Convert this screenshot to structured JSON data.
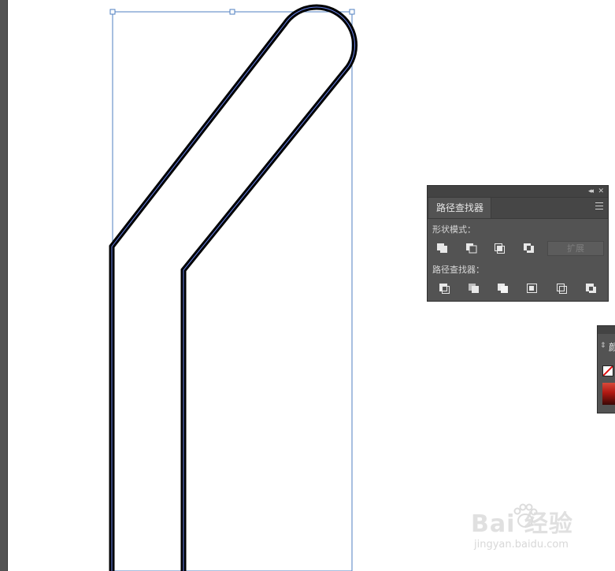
{
  "pathfinder": {
    "tab_title": "路径查找器",
    "shape_modes_label": "形状模式：",
    "pathfinders_label": "路径查找器：",
    "expand_label": "扩展",
    "shape_mode_icons": [
      "unite-icon",
      "minus-front-icon",
      "intersect-icon",
      "exclude-icon"
    ],
    "pathfinder_icons": [
      "divide-icon",
      "trim-icon",
      "merge-icon",
      "crop-icon",
      "outline-icon",
      "minus-back-icon"
    ]
  },
  "color_panel": {
    "tab_fragment": "颜"
  },
  "watermark": {
    "logo": "Bai  经验",
    "url": "jingyan.baidu.com"
  },
  "colors": {
    "ui_panel": "#535353",
    "selection_blue": "#4a6fd8",
    "stroke": "#000000"
  }
}
